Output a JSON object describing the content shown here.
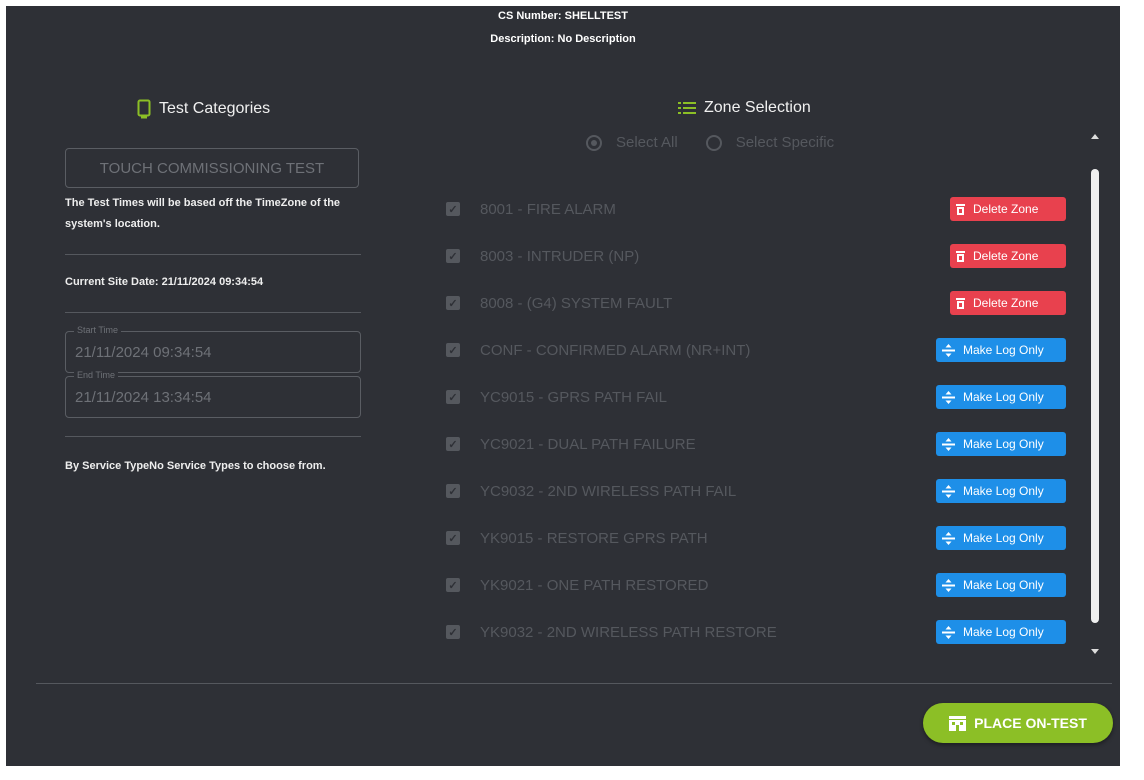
{
  "header": {
    "cs_number": "CS Number: SHELLTEST",
    "description": "Description: No Description"
  },
  "test_categories": {
    "title": "Test Categories",
    "icon": "phone-icon",
    "category_value": "TOUCH COMMISSIONING TEST",
    "timezone_note": "The Test Times will be based off the TimeZone of the system's location.",
    "current_site_date": "Current Site Date: 21/11/2024 09:34:54",
    "start_time_label": "Start Time",
    "start_time_value": "21/11/2024 09:34:54",
    "end_time_label": "End Time",
    "end_time_value": "21/11/2024 13:34:54",
    "service_type_note": "By Service TypeNo Service Types to choose from."
  },
  "zone_selection": {
    "title": "Zone Selection",
    "icon": "list-icon",
    "select_all_label": "Select All",
    "select_specific_label": "Select Specific",
    "selected_mode": "Select All",
    "zones": [
      {
        "label": "8001 - FIRE ALARM",
        "action": "Delete Zone",
        "action_type": "delete",
        "checked": true
      },
      {
        "label": "8003 - INTRUDER (NP)",
        "action": "Delete Zone",
        "action_type": "delete",
        "checked": true
      },
      {
        "label": "8008 - (G4) SYSTEM FAULT",
        "action": "Delete Zone",
        "action_type": "delete",
        "checked": true
      },
      {
        "label": "CONF - CONFIRMED ALARM (NR+INT)",
        "action": "Make Log Only",
        "action_type": "log",
        "checked": true
      },
      {
        "label": "YC9015 - GPRS PATH FAIL",
        "action": "Make Log Only",
        "action_type": "log",
        "checked": true
      },
      {
        "label": "YC9021 - DUAL PATH FAILURE",
        "action": "Make Log Only",
        "action_type": "log",
        "checked": true
      },
      {
        "label": "YC9032 - 2ND WIRELESS PATH FAIL",
        "action": "Make Log Only",
        "action_type": "log",
        "checked": true
      },
      {
        "label": "YK9015 - RESTORE GPRS PATH",
        "action": "Make Log Only",
        "action_type": "log",
        "checked": true
      },
      {
        "label": "YK9021 - ONE PATH RESTORED",
        "action": "Make Log Only",
        "action_type": "log",
        "checked": true
      },
      {
        "label": "YK9032 - 2ND WIRELESS PATH RESTORE",
        "action": "Make Log Only",
        "action_type": "log",
        "checked": true
      }
    ]
  },
  "footer": {
    "place_on_test_label": "PLACE ON-TEST"
  },
  "colors": {
    "background": "#2e3036",
    "accent_green": "#8cbf26",
    "delete_red": "#e8414e",
    "log_blue": "#1e8fe8",
    "disabled_text": "#55585e"
  }
}
